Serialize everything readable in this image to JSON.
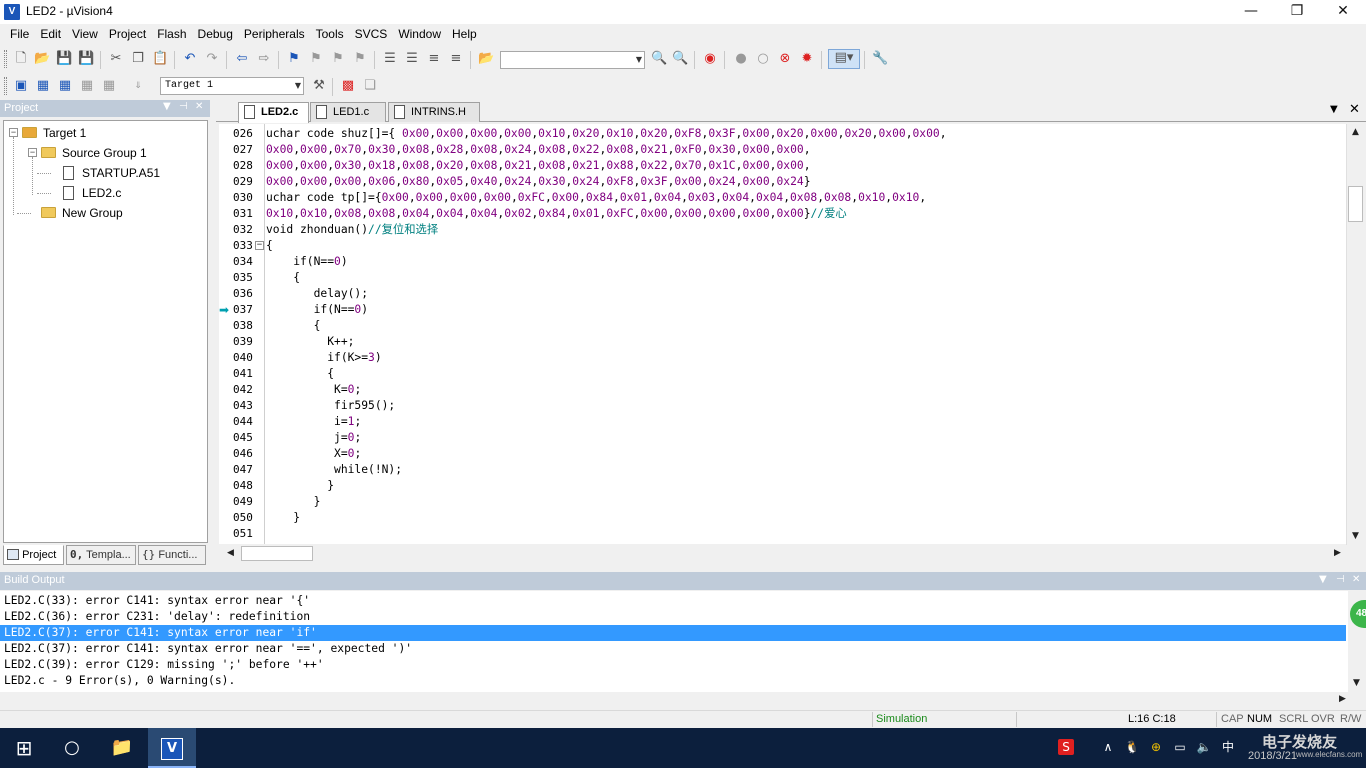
{
  "window": {
    "title": "LED2  - µVision4",
    "app_icon": "V",
    "controls": {
      "minimize": "—",
      "maximize": "❐",
      "close": "✕"
    }
  },
  "menu": [
    "File",
    "Edit",
    "View",
    "Project",
    "Flash",
    "Debug",
    "Peripherals",
    "Tools",
    "SVCS",
    "Window",
    "Help"
  ],
  "toolbar2": {
    "target_select": "Target 1"
  },
  "project_pane": {
    "title": "Project",
    "tree": {
      "target": "Target 1",
      "source_group": "Source Group 1",
      "files": [
        "STARTUP.A51",
        "LED2.c"
      ],
      "new_group": "New Group"
    },
    "tabs": [
      "Project",
      "Templa...",
      "Functi..."
    ],
    "tab_icons": [
      "book-icon",
      "template-icon",
      "braces-icon"
    ]
  },
  "editor": {
    "tabs": [
      "LED2.c",
      "LED1.c",
      "INTRINS.H"
    ],
    "active_tab": "LED2.c",
    "lines": [
      {
        "n": "026",
        "t": "uchar code shuz[]={ 0x00,0x00,0x00,0x00,0x10,0x20,0x10,0x20,0xF8,0x3F,0x00,0x20,0x00,0x20,0x00,0x00,"
      },
      {
        "n": "027",
        "t": "0x00,0x00,0x70,0x30,0x08,0x28,0x08,0x24,0x08,0x22,0x08,0x21,0xF0,0x30,0x00,0x00,"
      },
      {
        "n": "028",
        "t": "0x00,0x00,0x30,0x18,0x08,0x20,0x08,0x21,0x08,0x21,0x88,0x22,0x70,0x1C,0x00,0x00,"
      },
      {
        "n": "029",
        "t": "0x00,0x00,0x00,0x06,0x80,0x05,0x40,0x24,0x30,0x24,0xF8,0x3F,0x00,0x24,0x00,0x24}"
      },
      {
        "n": "030",
        "t": "uchar code tp[]={0x00,0x00,0x00,0x00,0xFC,0x00,0x84,0x01,0x04,0x03,0x04,0x04,0x08,0x08,0x10,0x10,"
      },
      {
        "n": "031",
        "t": "0x10,0x10,0x08,0x08,0x04,0x04,0x04,0x02,0x84,0x01,0xFC,0x00,0x00,0x00,0x00,0x00}//爱心"
      },
      {
        "n": "032",
        "t": "void zhonduan()//复位和选择"
      },
      {
        "n": "033",
        "t": "{"
      },
      {
        "n": "034",
        "t": "    if(N==0)"
      },
      {
        "n": "035",
        "t": "    {"
      },
      {
        "n": "036",
        "t": "       delay();"
      },
      {
        "n": "037",
        "t": "       if(N==0)"
      },
      {
        "n": "038",
        "t": "       {"
      },
      {
        "n": "039",
        "t": "         K++;"
      },
      {
        "n": "040",
        "t": "         if(K>=3)"
      },
      {
        "n": "041",
        "t": "         {"
      },
      {
        "n": "042",
        "t": "          K=0;"
      },
      {
        "n": "043",
        "t": "          fir595();"
      },
      {
        "n": "044",
        "t": "          i=1;"
      },
      {
        "n": "045",
        "t": "          j=0;"
      },
      {
        "n": "046",
        "t": "          X=0;"
      },
      {
        "n": "047",
        "t": "          while(!N);"
      },
      {
        "n": "048",
        "t": "         }"
      },
      {
        "n": "049",
        "t": "       }"
      },
      {
        "n": "050",
        "t": "    }"
      },
      {
        "n": "051",
        "t": ""
      }
    ],
    "current_line": "037",
    "fold_line": "033"
  },
  "build_output": {
    "title": "Build Output",
    "lines": [
      "LED2.C(33): error C141: syntax error near '{'",
      "LED2.C(36): error C231: 'delay': redefinition",
      "LED2.C(37): error C141: syntax error near 'if'",
      "LED2.C(37): error C141: syntax error near '==', expected ')'",
      "LED2.C(39): error C129: missing ';' before '++'",
      "LED2.c - 9 Error(s), 0 Warning(s)."
    ],
    "selected_index": 2,
    "badge": "48"
  },
  "statusbar": {
    "mode": "Simulation",
    "position": "L:16 C:18",
    "cap": "CAP",
    "num": "NUM",
    "scrl": "SCRL",
    "ovr": "OVR",
    "rw": "R/W"
  },
  "taskbar": {
    "clock_date": "2018/3/21",
    "watermark": "电子发烧友",
    "watermark_sub": "www.elecfans.com"
  },
  "colors": {
    "pane_header": "#bfcbd9",
    "selection": "#3399ff",
    "number_literal": "#800080",
    "comment": "#008080",
    "taskbar": "#0c1f3d",
    "status_mode": "#1a8a1a"
  }
}
